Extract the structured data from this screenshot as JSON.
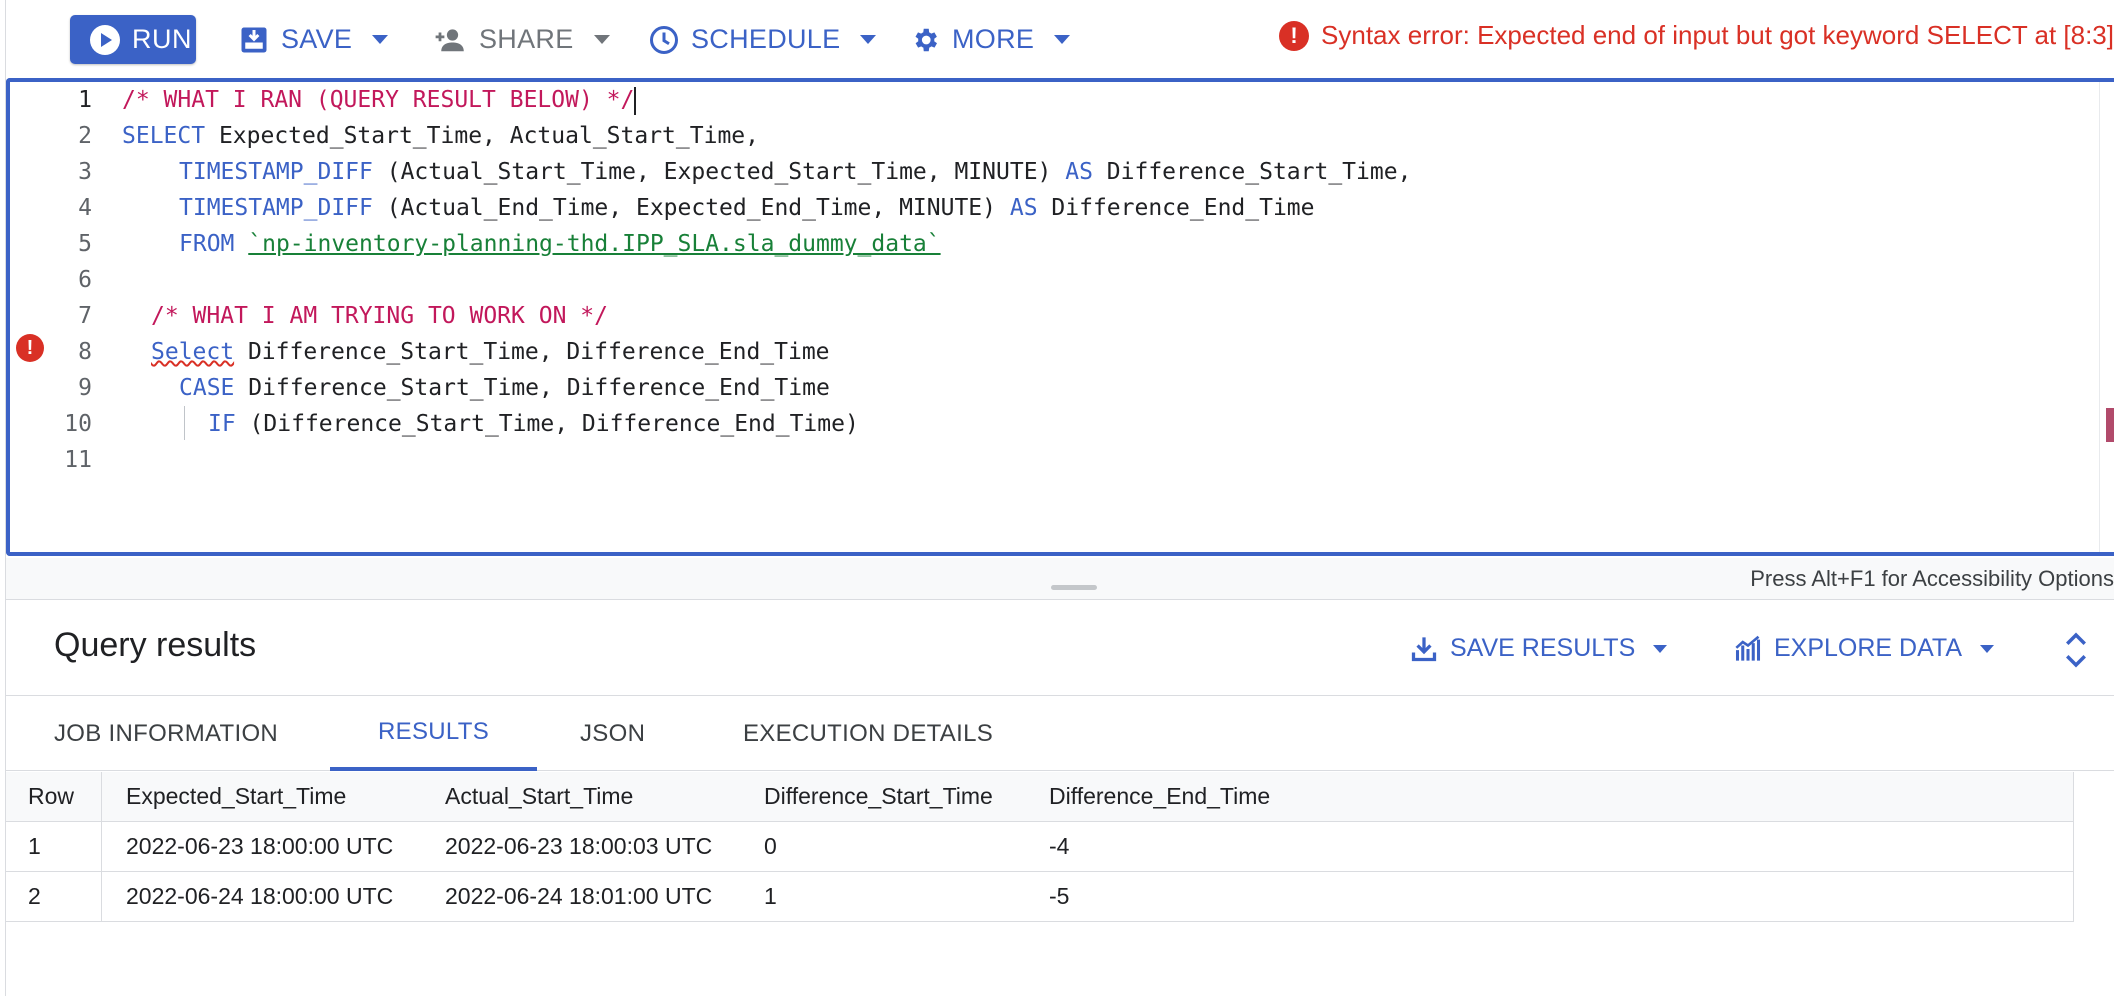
{
  "toolbar": {
    "run_label": "RUN",
    "save_label": "SAVE",
    "share_label": "SHARE",
    "schedule_label": "SCHEDULE",
    "more_label": "MORE"
  },
  "error": {
    "message": "Syntax error: Expected end of input but got keyword SELECT at [8:3]",
    "color": "#d93025"
  },
  "editor": {
    "line_numbers": [
      "1",
      "2",
      "3",
      "4",
      "5",
      "6",
      "7",
      "8",
      "9",
      "10",
      "11"
    ],
    "error_line": "8",
    "lines": {
      "l1_comment": "/* WHAT I RAN (QUERY RESULT BELOW) */",
      "l2_kw": "SELECT",
      "l2_rest": " Expected_Start_Time, Actual_Start_Time,",
      "l3_fn": "TIMESTAMP_DIFF",
      "l3_args": " (Actual_Start_Time, Expected_Start_Time, MINUTE) ",
      "l3_as": "AS",
      "l3_alias": " Difference_Start_Time,",
      "l4_fn": "TIMESTAMP_DIFF",
      "l4_args": " (Actual_End_Time, Expected_End_Time, MINUTE) ",
      "l4_as": "AS",
      "l4_alias": " Difference_End_Time",
      "l5_kw": "FROM",
      "l5_table": "`np-inventory-planning-thd.IPP_SLA.sla_dummy_data`",
      "l7_comment": "/* WHAT I AM TRYING TO WORK ON */",
      "l8_kw": "Select",
      "l8_rest": " Difference_Start_Time, Difference_End_Time",
      "l9_kw": "CASE",
      "l9_rest": " Difference_Start_Time, Difference_End_Time",
      "l10_kw": "IF",
      "l10_rest": " (Difference_Start_Time, Difference_End_Time)"
    }
  },
  "accessibility_hint": "Press Alt+F1 for Accessibility Options",
  "results": {
    "title": "Query results",
    "save_results_label": "SAVE RESULTS",
    "explore_data_label": "EXPLORE DATA",
    "tabs": [
      {
        "label": "JOB INFORMATION"
      },
      {
        "label": "RESULTS"
      },
      {
        "label": "JSON"
      },
      {
        "label": "EXECUTION DETAILS"
      }
    ],
    "active_tab": "RESULTS",
    "columns": [
      "Row",
      "Expected_Start_Time",
      "Actual_Start_Time",
      "Difference_Start_Time",
      "Difference_End_Time"
    ],
    "rows": [
      [
        "1",
        "2022-06-23 18:00:00 UTC",
        "2022-06-23 18:00:03 UTC",
        "0",
        "-4"
      ],
      [
        "2",
        "2022-06-24 18:00:00 UTC",
        "2022-06-24 18:01:00 UTC",
        "1",
        "-5"
      ]
    ]
  },
  "colors": {
    "accent": "#3b62c6",
    "keyword": "#3b62c6",
    "comment": "#c2185b",
    "string": "#188038"
  },
  "icons": {
    "run": "play-circle-icon",
    "save": "save-download-icon",
    "share": "person-add-icon",
    "schedule": "clock-icon",
    "more": "gear-icon",
    "error": "error-circle-icon",
    "save_results": "download-icon",
    "explore_data": "chart-icon",
    "expand": "unfold-icon"
  }
}
